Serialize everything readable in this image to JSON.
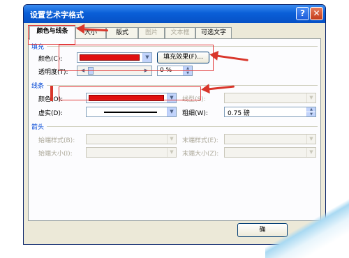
{
  "dialog": {
    "title": "设置艺术字格式",
    "help_glyph": "?",
    "close_glyph": "✕"
  },
  "tabs": [
    {
      "label": "颜色与线条",
      "active": true,
      "enabled": true
    },
    {
      "label": "大小",
      "active": false,
      "enabled": true
    },
    {
      "label": "版式",
      "active": false,
      "enabled": true
    },
    {
      "label": "图片",
      "active": false,
      "enabled": false
    },
    {
      "label": "文本框",
      "active": false,
      "enabled": false
    },
    {
      "label": "可选文字",
      "active": false,
      "enabled": true
    }
  ],
  "fill": {
    "section": "填充",
    "color_label": "颜色(C):",
    "color_value": "#e01010",
    "effects_button": "填充效果(F)...",
    "transparency_label": "透明度(T):",
    "transparency_value": "0 %"
  },
  "line": {
    "section": "线条",
    "color_label": "颜色(O):",
    "color_value": "#e01010",
    "type_label": "线型(S):",
    "dash_label": "虚实(D):",
    "weight_label": "粗细(W):",
    "weight_value": "0.75 磅"
  },
  "arrows": {
    "section": "箭头",
    "begin_style_label": "始端样式(B):",
    "end_style_label": "末端样式(E):",
    "begin_size_label": "始端大小(I):",
    "end_size_label": "末端大小(Z):"
  },
  "footer": {
    "ok_button": "确"
  },
  "icons": {
    "dropdown": "▼",
    "spin_up": "▲",
    "spin_down": "▼",
    "slider_left": "◀",
    "slider_right": "▶"
  },
  "colors": {
    "accent": "#0a5fd8",
    "annotation": "#d9362b"
  }
}
